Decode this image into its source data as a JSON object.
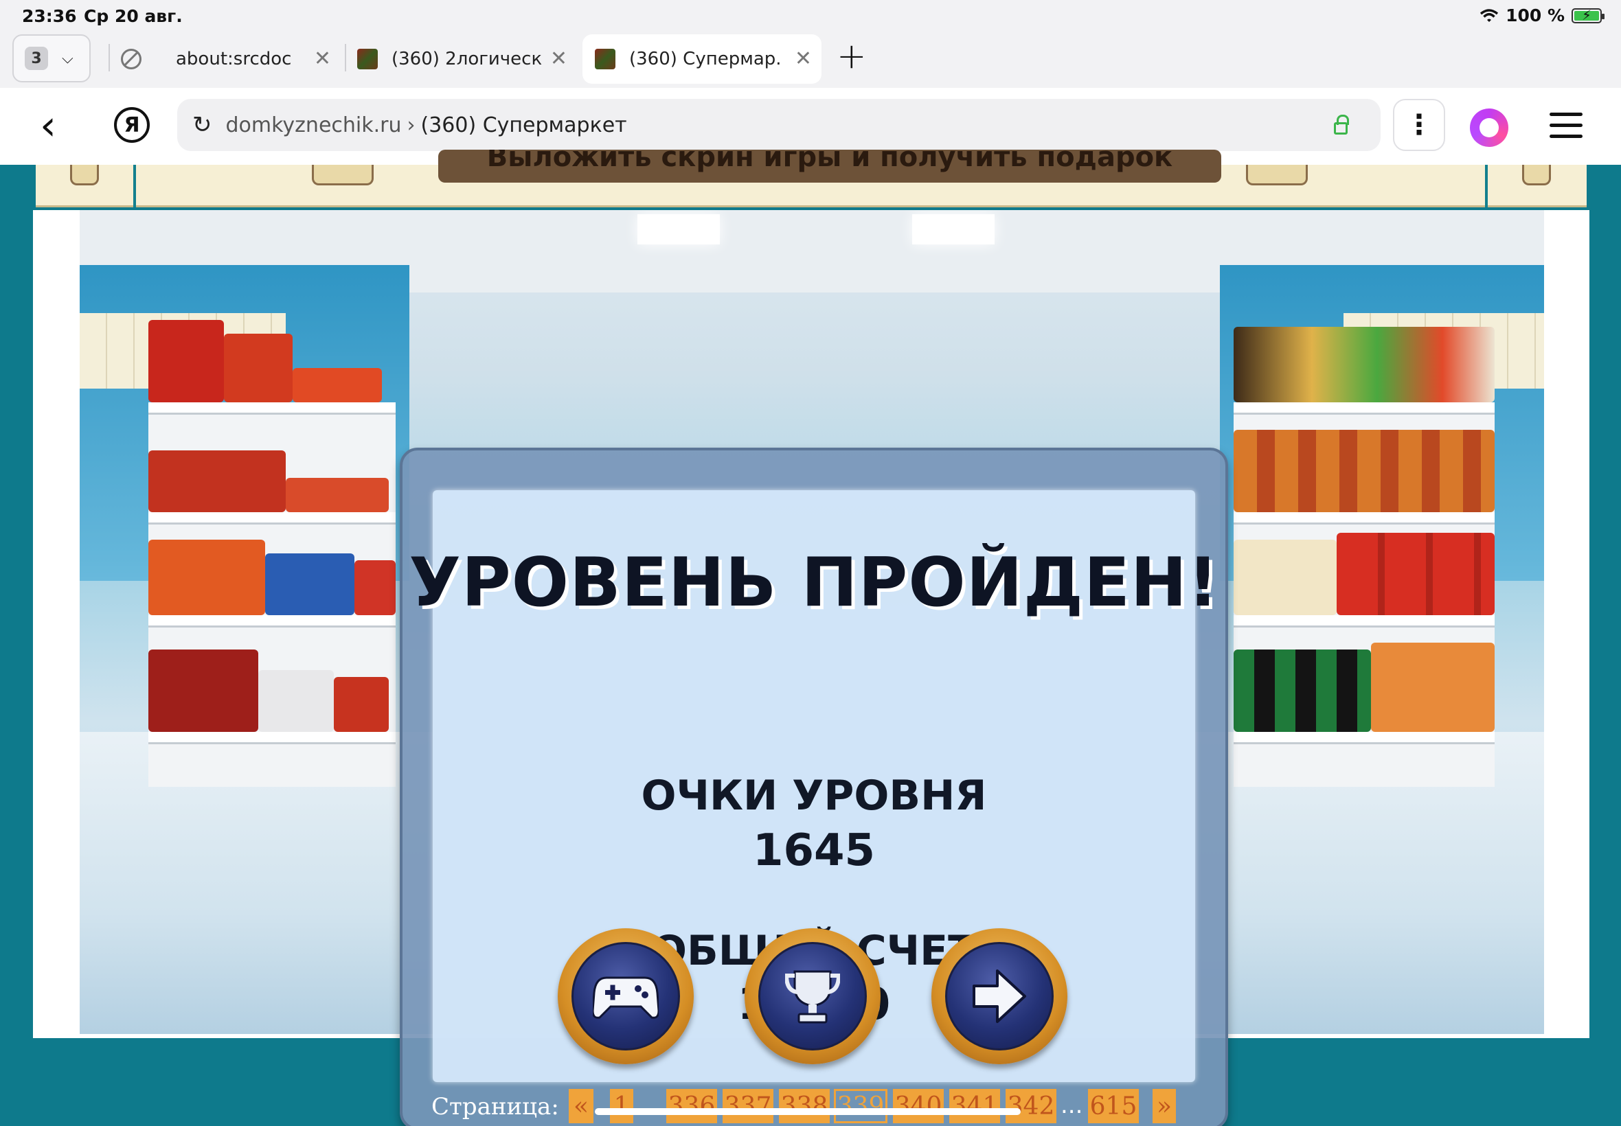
{
  "status_bar": {
    "time": "23:36",
    "date": "Ср 20 авг.",
    "battery": "100 %"
  },
  "tabs": {
    "count": "3",
    "items": [
      {
        "label": "about:srcdoc"
      },
      {
        "label": "(360) 2логическ..."
      },
      {
        "label": "(360) Супермар..."
      }
    ]
  },
  "address_bar": {
    "domain": "domkyznechik.ru",
    "separator": "›",
    "page_title": "(360) Супермаркет"
  },
  "banner": {
    "text": "Выложить скрин игры и получить подарок"
  },
  "game": {
    "title": "УРОВЕНЬ ПРОЙДЕН!",
    "level_score_label": "ОЧКИ УРОВНЯ",
    "level_score_value": "1645",
    "total_score_label": "ОБЩИЙ СЧЕТ",
    "total_score_value": "10360",
    "buttons": [
      {
        "icon": "gamepad-icon"
      },
      {
        "icon": "trophy-icon"
      },
      {
        "icon": "arrow-right-icon"
      }
    ]
  },
  "pagination": {
    "label": "Страница:",
    "prev": "«",
    "first": "1",
    "pages": [
      "336",
      "337",
      "338",
      "339",
      "340",
      "341",
      "342"
    ],
    "current": "339",
    "ellipsis": "...",
    "last": "615",
    "next": "»"
  },
  "colors": {
    "page_bg": "#0e7a8c",
    "pager_accent": "#f0a33a",
    "dialog_frame": "#7896b9"
  }
}
